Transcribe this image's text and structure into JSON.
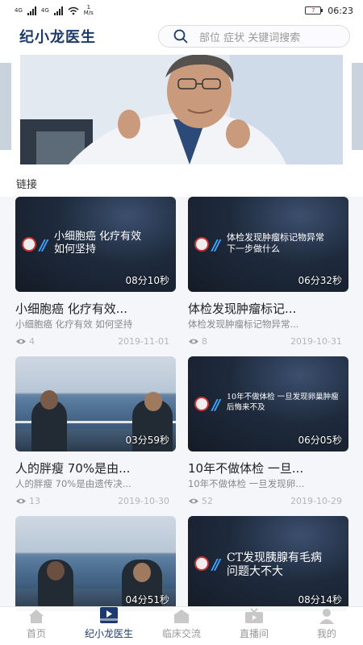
{
  "status_bar": {
    "network_1": "4G",
    "network_2": "4G",
    "speed_value": "1",
    "speed_unit": "M/s",
    "battery": "7",
    "time": "06:23"
  },
  "header": {
    "title": "纪小龙医生",
    "search_placeholder": "部位 症状 关键词搜索"
  },
  "section": {
    "label": "链接"
  },
  "cards": [
    {
      "thumb_text": "小细胞癌 化疗有效\n如何坚持",
      "duration": "08分10秒",
      "title": "小细胞癌 化疗有效...",
      "subtitle": "小细胞癌 化疗有效 如何坚持",
      "views": "4",
      "date": "2019-11-01"
    },
    {
      "thumb_text": "体检发现肿瘤标记物异常\n下一步做什么",
      "duration": "06分32秒",
      "title": "体检发现肿瘤标记...",
      "subtitle": "体检发现肿瘤标记物异常...",
      "views": "8",
      "date": "2019-10-31"
    },
    {
      "thumb_text": "",
      "duration": "03分59秒",
      "title": "人的胖瘦 70%是由...",
      "subtitle": "人的胖瘦 70%是由遗传决...",
      "views": "13",
      "date": "2019-10-30"
    },
    {
      "thumb_text": "10年不做体检 一旦发现卵巢肿瘤\n后悔来不及",
      "duration": "06分05秒",
      "title": "10年不做体检 一旦...",
      "subtitle": "10年不做体检 一旦发现卵...",
      "views": "52",
      "date": "2019-10-29"
    },
    {
      "thumb_text": "",
      "duration": "04分51秒",
      "title": "",
      "subtitle": "",
      "views": "",
      "date": ""
    },
    {
      "thumb_text": "CT发现胰腺有毛病\n问题大不大",
      "duration": "08分14秒",
      "title": "",
      "subtitle": "",
      "views": "",
      "date": ""
    }
  ],
  "tabs": [
    {
      "label": "首页",
      "icon": "home-icon"
    },
    {
      "label": "纪小龙医生",
      "icon": "video-play-icon"
    },
    {
      "label": "临床交流",
      "icon": "clinic-icon"
    },
    {
      "label": "直播间",
      "icon": "tv-icon"
    },
    {
      "label": "我的",
      "icon": "user-icon"
    }
  ],
  "colors": {
    "brand": "#1c3a6b",
    "accent_blue": "#3fa3ff"
  }
}
